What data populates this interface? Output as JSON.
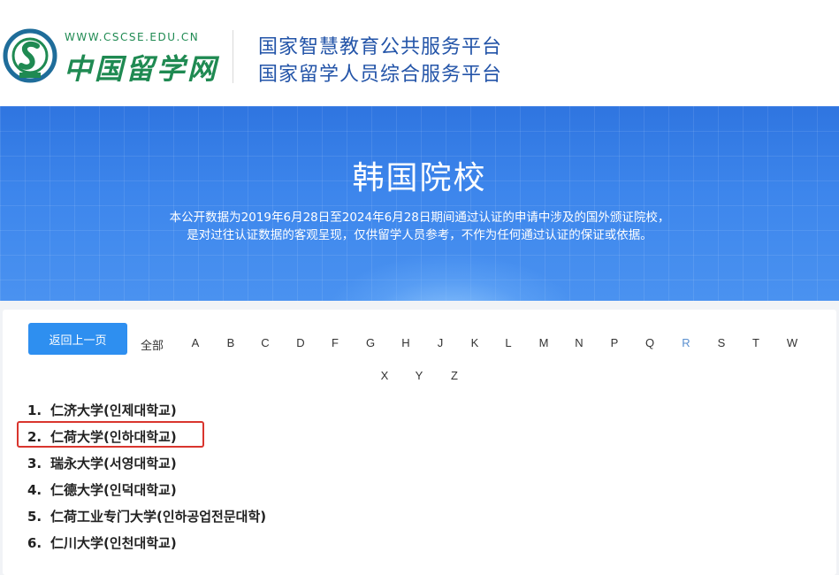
{
  "header": {
    "logo_url_text": "WWW.CSCSE.EDU.CN",
    "logo_name": "中国留学网",
    "title_line1": "国家智慧教育公共服务平台",
    "title_line2": "国家留学人员综合服务平台",
    "brand_color": "#1f8a52",
    "title_color": "#2354a8"
  },
  "banner": {
    "title": "韩国院校",
    "desc_line1": "本公开数据为2019年6月28日至2024年6月28日期间通过认证的申请中涉及的国外颁证院校，",
    "desc_line2": "是对过往认证数据的客观呈现，仅供留学人员参考，不作为任何通过认证的保证或依据。"
  },
  "nav": {
    "back_label": "返回上一页",
    "letters": [
      "全部",
      "A",
      "B",
      "C",
      "D",
      "F",
      "G",
      "H",
      "J",
      "K",
      "L",
      "M",
      "N",
      "P",
      "Q",
      "R",
      "S",
      "T",
      "W",
      "X",
      "Y",
      "Z"
    ],
    "active_letter": "R"
  },
  "schools": [
    {
      "num": "1.",
      "name": "仁济大学(인제대학교)"
    },
    {
      "num": "2.",
      "name": "仁荷大学(인하대학교)"
    },
    {
      "num": "3.",
      "name": "瑞永大学(서영대학교)"
    },
    {
      "num": "4.",
      "name": "仁德大学(인덕대학교)"
    },
    {
      "num": "5.",
      "name": "仁荷工业专门大学(인하공업전문대학)"
    },
    {
      "num": "6.",
      "name": "仁川大学(인천대학교)"
    }
  ],
  "highlighted_school_index": 1,
  "accent_color": "#2e8ff0",
  "highlight_color": "#d9352e"
}
